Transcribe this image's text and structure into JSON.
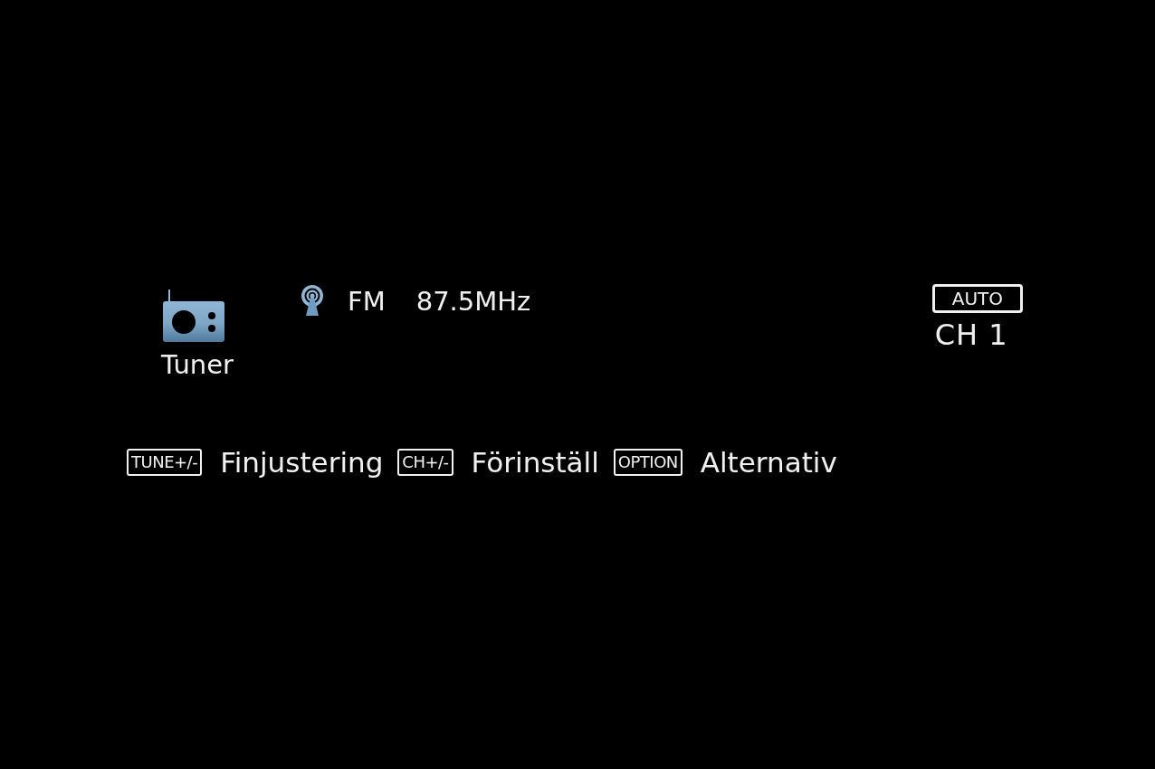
{
  "source": {
    "label": "Tuner"
  },
  "station": {
    "band": "FM",
    "frequency": "87.5MHz"
  },
  "preset": {
    "mode_badge": "AUTO",
    "channel": "CH 1"
  },
  "hints": [
    {
      "key": "TUNE+/-",
      "action": "Finjustering"
    },
    {
      "key": "CH+/-",
      "action": "Förinställ"
    },
    {
      "key": "OPTION",
      "action": "Alternativ"
    }
  ]
}
